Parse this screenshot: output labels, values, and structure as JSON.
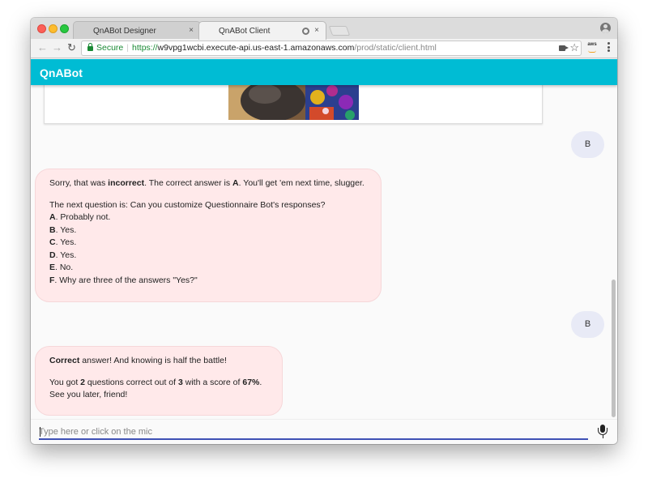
{
  "browser": {
    "tabs": [
      {
        "label": "QnABot Designer"
      },
      {
        "label": "QnABot Client"
      }
    ],
    "tab_close": "×",
    "nav": {
      "back": "←",
      "forward": "→",
      "reload": "↻"
    },
    "address": {
      "secure_label": "Secure",
      "scheme": "https://",
      "host": "w9vpg1wcbi.execute-api.us-east-1.amazonaws.com",
      "path": "/prod/static/client.html"
    },
    "bookmark_glyph": "☆",
    "extension_label": "aws"
  },
  "app": {
    "title": "QnABot"
  },
  "messages": {
    "user_reply_1": "B",
    "bot_reply_1": {
      "p1_pre": "Sorry, that was ",
      "p1_bold": "incorrect",
      "p1_mid": ". The correct answer is ",
      "p1_answer": "A",
      "p1_post": ". You'll get 'em next time, slugger.",
      "question": "The next question is: Can you customize Questionnaire Bot's responses?",
      "options": [
        {
          "key": "A",
          "text": ". Probably not."
        },
        {
          "key": "B",
          "text": ". Yes."
        },
        {
          "key": "C",
          "text": ". Yes."
        },
        {
          "key": "D",
          "text": ". Yes."
        },
        {
          "key": "E",
          "text": ". No."
        },
        {
          "key": "F",
          "text": ". Why are three of the answers \"Yes?\""
        }
      ]
    },
    "user_reply_2": "B",
    "bot_reply_2": {
      "p1_bold": "Correct",
      "p1_post": " answer! And knowing is half the battle!",
      "p2_pre": "You got ",
      "p2_correct": "2",
      "p2_mid": " questions correct out of ",
      "p2_total": "3",
      "p2_mid2": " with a score of ",
      "p2_score": "67%",
      "p2_post": ".",
      "p2_line2": "See you later, friend!"
    }
  },
  "input": {
    "placeholder": "Type here or click on the mic",
    "value": ""
  },
  "colors": {
    "appbar": "#00bcd4",
    "bot_bubble": "#ffe9ea",
    "user_bubble": "#e8eaf6",
    "input_underline": "#3f51b5"
  }
}
